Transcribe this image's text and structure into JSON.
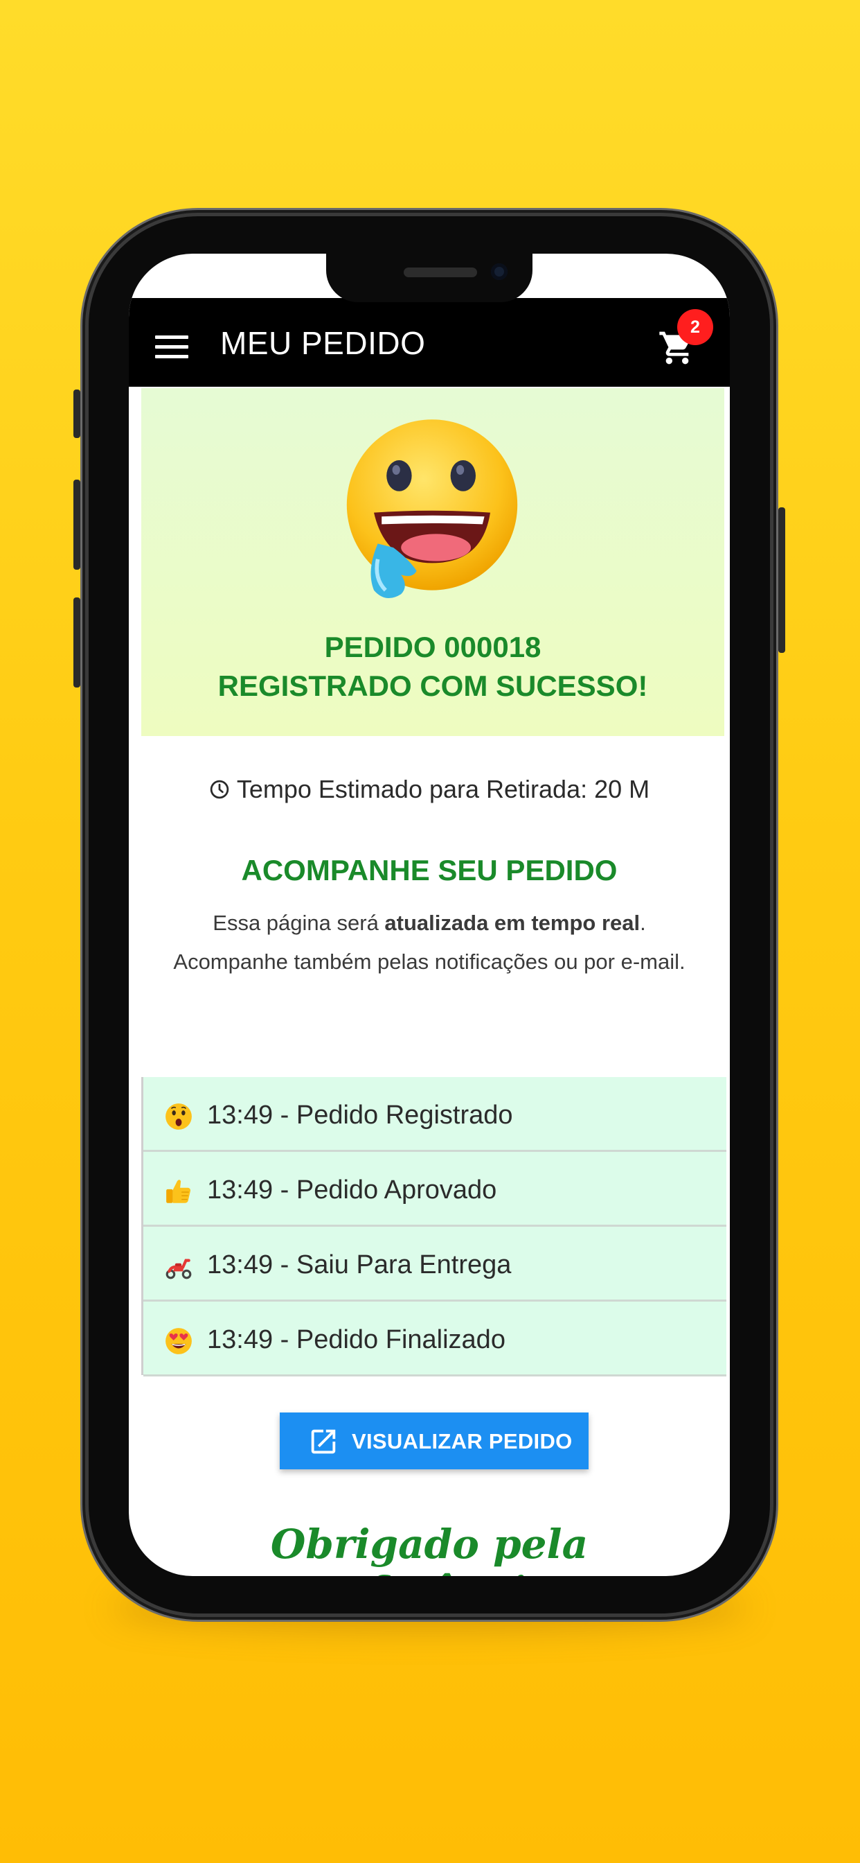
{
  "app_bar": {
    "title": "MEU PEDIDO",
    "menu_icon": "hamburger-menu-icon",
    "cart_icon": "shopping-cart-icon",
    "cart_count": "2"
  },
  "order": {
    "line1": "PEDIDO 000018",
    "line2": "REGISTRADO COM SUCESSO!",
    "emoji": "drooling-face-emoji"
  },
  "estimate": {
    "icon": "clock-icon",
    "text": "Tempo Estimado para Retirada: 20 M"
  },
  "follow": {
    "title": "ACOMPANHE SEU PEDIDO",
    "info_prefix": "Essa página será ",
    "info_bold": "atualizada em tempo real",
    "info_suffix": ".",
    "info_line2": "Acompanhe também pelas notificações ou por e-mail."
  },
  "timeline": [
    {
      "label": "13:49 - Pedido Registrado",
      "icon": "surprised-face-emoji"
    },
    {
      "label": "13:49 - Pedido Aprovado",
      "icon": "thumbs-up-emoji"
    },
    {
      "label": "13:49 - Saiu Para Entrega",
      "icon": "scooter-emoji"
    },
    {
      "label": "13:49 - Pedido Finalizado",
      "icon": "heart-eyes-emoji"
    }
  ],
  "actions": {
    "view_order": "VISUALIZAR PEDIDO",
    "view_icon": "open-external-icon"
  },
  "footer": {
    "thanks": "Obrigado pela preferência."
  },
  "colors": {
    "background": "#ffcb12",
    "accent_green": "#1a8a2a",
    "button_blue": "#1c8ff2",
    "badge_red": "#ff1e1e",
    "timeline_bg": "#dcfcea",
    "success_bg": "#eefcc0"
  }
}
